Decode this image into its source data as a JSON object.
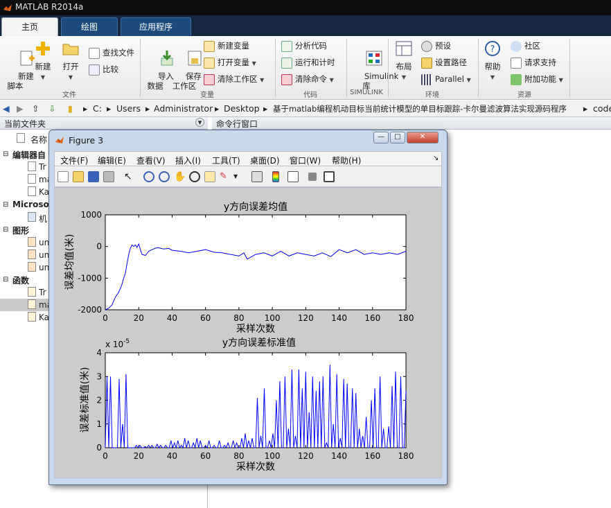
{
  "app": {
    "title": "MATLAB R2014a"
  },
  "tabs": [
    {
      "label": "主页"
    },
    {
      "label": "绘图"
    },
    {
      "label": "应用程序"
    }
  ],
  "ribbon": {
    "file": {
      "new_script": "新建\n脚本",
      "new": "新建",
      "open": "打开",
      "find_files": "查找文件",
      "compare": "比较",
      "group": "文件"
    },
    "variable": {
      "import": "导入\n数据",
      "save_ws": "保存\n工作区",
      "new_var": "新建变量",
      "open_var": "打开变量",
      "clear_ws": "清除工作区",
      "group": "变量"
    },
    "code": {
      "analyze": "分析代码",
      "run_time": "运行和计时",
      "clear_cmd": "清除命令",
      "group": "代码"
    },
    "simulink": {
      "lib": "Simulink\n库",
      "group": "SIMULINK"
    },
    "env": {
      "layout": "布局",
      "prefs": "预设",
      "set_path": "设置路径",
      "parallel": "Parallel",
      "group": "环境"
    },
    "resources": {
      "help": "帮助",
      "community": "社区",
      "support": "请求支持",
      "addons": "附加功能",
      "group": "资源"
    }
  },
  "address": {
    "parts": [
      "C:",
      "Users",
      "Administrator",
      "Desktop",
      "基于matlab编程机动目标当前统计模型的单目标跟踪-卡尔曼滤波算法实现源码程序",
      "code"
    ]
  },
  "leftpane": {
    "title": "当前文件夹",
    "name_col": "名称",
    "items": [
      {
        "label": "编辑器自",
        "bold": true
      },
      {
        "label": "Tr"
      },
      {
        "label": "ma"
      },
      {
        "label": "Ka"
      },
      {
        "label": "Microsof",
        "bold": true
      },
      {
        "label": "机"
      },
      {
        "label": "图形",
        "bold": true
      },
      {
        "label": "un"
      },
      {
        "label": "un"
      },
      {
        "label": "un"
      },
      {
        "label": "函数",
        "bold": true
      },
      {
        "label": "Tr"
      },
      {
        "label": "ma"
      },
      {
        "label": "Ka"
      }
    ]
  },
  "rightpane": {
    "title": "命令行窗口"
  },
  "figure": {
    "title": "Figure 3",
    "menu": [
      "文件(F)",
      "编辑(E)",
      "查看(V)",
      "插入(I)",
      "工具(T)",
      "桌面(D)",
      "窗口(W)",
      "帮助(H)"
    ]
  },
  "chart_data": [
    {
      "type": "line",
      "title": "y方向误差均值",
      "xlabel": "采样次数",
      "ylabel": "误差均值(米)",
      "xlim": [
        0,
        180
      ],
      "ylim": [
        -2000,
        1000
      ],
      "xticks": [
        "0",
        "20",
        "40",
        "60",
        "80",
        "100",
        "120",
        "140",
        "160",
        "180"
      ],
      "yticks": [
        "-2000",
        "-1000",
        "0",
        "1000"
      ],
      "color": "#0000ff",
      "x": [
        0,
        2,
        4,
        6,
        8,
        10,
        11,
        12,
        13,
        14,
        15,
        16,
        17,
        18,
        19,
        20,
        21,
        22,
        24,
        26,
        28,
        30,
        32,
        35,
        38,
        40,
        45,
        50,
        55,
        60,
        65,
        70,
        75,
        80,
        83,
        85,
        90,
        95,
        100,
        105,
        110,
        115,
        120,
        125,
        130,
        135,
        140,
        145,
        150,
        155,
        160,
        165,
        170,
        175,
        180
      ],
      "y": [
        -2000,
        -1950,
        -1850,
        -1600,
        -1450,
        -1200,
        -1000,
        -850,
        -550,
        -250,
        -50,
        50,
        0,
        50,
        -30,
        80,
        -100,
        -250,
        -280,
        -150,
        -100,
        -50,
        -40,
        -80,
        -60,
        -120,
        -150,
        -200,
        -150,
        -100,
        -180,
        -200,
        -250,
        -300,
        -200,
        -400,
        -250,
        -200,
        -300,
        -150,
        -300,
        -200,
        -250,
        -300,
        -200,
        -320,
        -100,
        -200,
        -100,
        -250,
        -200,
        -250,
        -200,
        -250,
        -150
      ]
    },
    {
      "type": "line",
      "title": "y方向误差标准值",
      "xlabel": "采样次数",
      "ylabel": "误差标准值(米)",
      "exponent_label": "x 10",
      "exponent": "-5",
      "xlim": [
        0,
        180
      ],
      "ylim": [
        0,
        4
      ],
      "xticks": [
        "0",
        "20",
        "40",
        "60",
        "80",
        "100",
        "120",
        "140",
        "160",
        "180"
      ],
      "yticks": [
        "0",
        "1",
        "2",
        "3",
        "4"
      ],
      "color": "#0000ff",
      "y": [
        0,
        3.0,
        0,
        3.0,
        0,
        0,
        0,
        0,
        2.9,
        0,
        1.0,
        0,
        3.1,
        0,
        0,
        0,
        0,
        0,
        0.1,
        0,
        0.1,
        0,
        0,
        0.05,
        0,
        0.1,
        0,
        0.1,
        0,
        0,
        0.15,
        0,
        0.1,
        0,
        0,
        0.1,
        0,
        0,
        0.3,
        0,
        0.2,
        0,
        0.3,
        0,
        0.1,
        0,
        0.4,
        0,
        0.3,
        0,
        0,
        0.2,
        0,
        0.4,
        0,
        0.3,
        0,
        0,
        0.1,
        0,
        0.3,
        0,
        0,
        0.1,
        0,
        0,
        0.3,
        0,
        0,
        0.1,
        0,
        0.2,
        0,
        0,
        0.3,
        0,
        0.2,
        0,
        0,
        0.4,
        0,
        0.6,
        0,
        0.3,
        0,
        0.4,
        0,
        0,
        2.1,
        0,
        0.5,
        0,
        2.5,
        0,
        0,
        0.3,
        0,
        0.6,
        0,
        2.0,
        0,
        2.8,
        0,
        0,
        3.0,
        0,
        0.8,
        0,
        3.3,
        0,
        0.5,
        0,
        3.3,
        0,
        2.5,
        0,
        3.2,
        0,
        1.5,
        0,
        3.0,
        0,
        2.4,
        0,
        2.8,
        0,
        3.0,
        0,
        0.2,
        0,
        3.5,
        0,
        1.0,
        0,
        3.1,
        0,
        0.4,
        0,
        2.9,
        0,
        2.7,
        0,
        0,
        2.5,
        0,
        2.3,
        0,
        0.8,
        0,
        0.5,
        0,
        1.3,
        0,
        0,
        2.0,
        0,
        2.5,
        0,
        0,
        3.0,
        0,
        0.8,
        0,
        0,
        0.9,
        0,
        2.6,
        0,
        3.2,
        0,
        0,
        3.0,
        0,
        0,
        2.4
      ]
    }
  ]
}
